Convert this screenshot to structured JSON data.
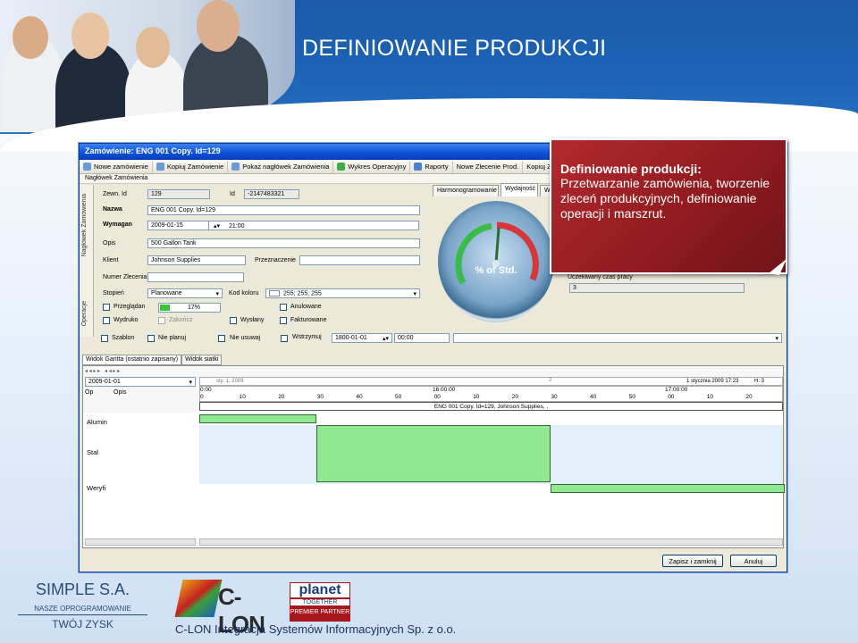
{
  "slide": {
    "title": "DEFINIOWANIE PRODUKCJI",
    "footer_company": "SIMPLE S.A.",
    "footer_tagline": "NASZE OPROGRAMOWANIE",
    "footer_slogan": "TWÓJ ZYSK",
    "footer_text": "C-LON Integracja Systemów Informacyjnych Sp. z o.o.",
    "logo_clon": "C-LON",
    "logo_planet_1": "planet",
    "logo_planet_2": "TOGETHER",
    "logo_planet_3": "PREMIER PARTNER"
  },
  "callout": {
    "heading": "Definiowanie produkcji:",
    "body": "Przetwarzanie zamówienia, tworzenie zleceń produkcyjnych, definiowanie operacji i marszrut."
  },
  "window": {
    "title": "Zamówienie: ENG 001 Copy. Id=129",
    "toolbar": [
      "Nowe zamówienie",
      "Kopiuj Zamówienie",
      "Pokaż nagłówek Zamówienia",
      "Wykres Operacyjny",
      "Raporty",
      "Nowe Zlecenie Prod.",
      "Kopiuj Zlecenie"
    ],
    "section": "Nagłówek Zamówienia",
    "side_tab_1": "Nagłówek Zamówienia",
    "side_tab_2": "Operacje"
  },
  "form": {
    "zewn_id_label": "Zewn. Id",
    "zewn_id_value": "129",
    "id_label": "Id",
    "id_value": "-2147483321",
    "nazwa_label": "Nazwa",
    "nazwa_value": "ENG 001 Copy. Id=129",
    "wymagan_label": "Wymagan",
    "wymagan_date": "2009-01-15",
    "wymagan_time": "21:00",
    "opis_label": "Opis",
    "opis_value": "500 Gallon Tank",
    "klient_label": "Klient",
    "klient_value": "Johnson Supplies",
    "przeznaczenie_label": "Przeznaczenie",
    "numer_label": "Numer Zlecenia",
    "stopien_label": "Stopień",
    "stopien_value": "Planowane",
    "kod_koloru_label": "Kod koloru",
    "kod_koloru_value": "255; 255; 255",
    "przegladan_label": "Przeglądan",
    "progress_value": "17%",
    "progress_fraction": 0.17,
    "wydruko_label": "Wydruko",
    "zakoncz_label": "Zakończ",
    "wyslany_label": "Wysłany",
    "anulowane_label": "Anulowane",
    "fakturowane_label": "Fakturowane",
    "szablon_label": "Szablon",
    "nie_planuj_label": "Nie planuj",
    "nie_usuwaj_label": "Nie usuwaj",
    "wstrzymuj_label": "Wstrzymuj",
    "wstrzymuj_date": "1800-01-01",
    "wstrzymuj_time": "00:00"
  },
  "right_panel": {
    "tab_harmonogramowanie": "Harmonogramowanie",
    "tab_wydajnosc": "Wydajność",
    "tab_w": "W",
    "gauge_label": "% of Std.",
    "czas_label": "Uczekiwany czas pracy",
    "czas_value": "3"
  },
  "gantt": {
    "tab1": "Widok Gantta (ostatnio zapisany)",
    "tab2": "Widok siatki",
    "date_value": "2009-01-01",
    "month_label": "sty. 1, 2009",
    "week_num": "2",
    "right_date": "1 stycznia 2009 17:23",
    "zoom": "H: 3",
    "col_op": "Op",
    "col_opis": "Opis",
    "times": [
      "0:00",
      "16:00:00",
      "17:00:00"
    ],
    "ticks": [
      "0",
      "10",
      "20",
      "30",
      "40",
      "50",
      "00",
      "10",
      "20",
      "30",
      "40",
      "50",
      "00",
      "10",
      "20"
    ],
    "order_bar": "ENG 001 Copy. Id=129, Johnson Supplies, ,",
    "rows": [
      "Alumin",
      "Stal",
      "Weryfi"
    ]
  },
  "buttons": {
    "save_close": "Zapisz i zamknij",
    "cancel": "Anuluj"
  }
}
